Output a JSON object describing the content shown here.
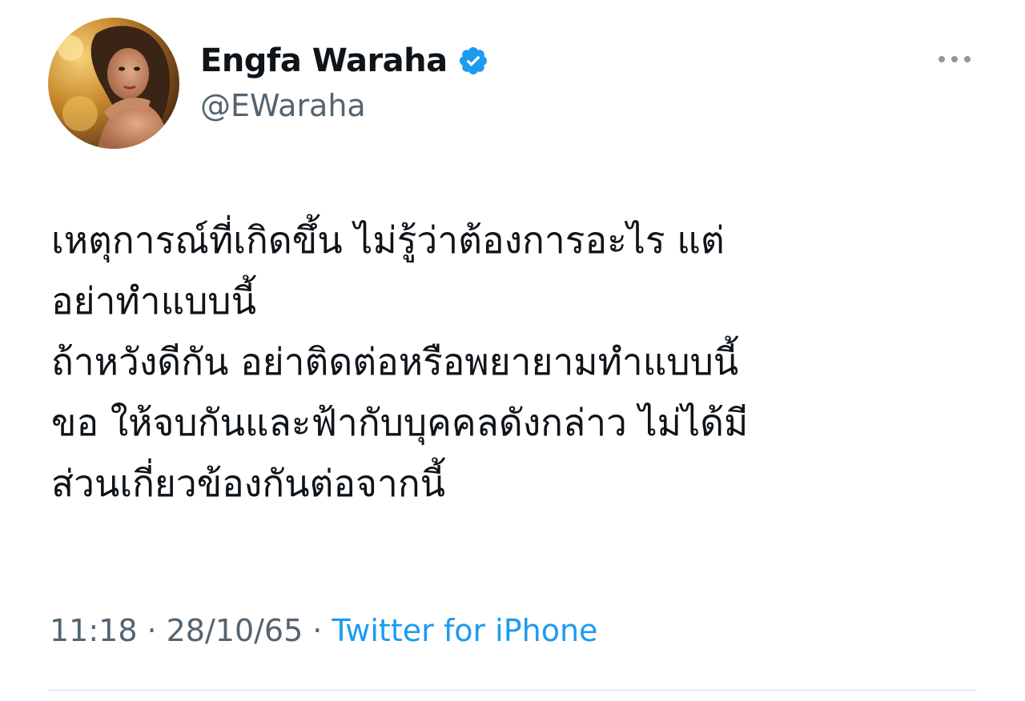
{
  "tweet": {
    "author": {
      "display_name": "Engfa Waraha",
      "handle": "@EWaraha",
      "verified_icon": "verified-badge-icon",
      "avatar_icon": "avatar-photo"
    },
    "more_icon": "more-dots-icon",
    "lines": [
      "เหตุการณ์ที่เกิดขึ้น ไม่รู้ว่าต้องการอะไร แต่",
      "อย่าทำแบบนี้",
      "ถ้าหวังดีกัน อย่าติดต่อหรือพยายามทำแบบนี้",
      "ขอ ให้จบกันและฟ้ากับบุคคลดังกล่าว ไม่ได้มี",
      "ส่วนเกี่ยวข้องกันต่อจากนี้"
    ],
    "time": "11:18",
    "date": "28/10/65",
    "separator": "·",
    "source": "Twitter for iPhone"
  },
  "colors": {
    "text": "#0f1419",
    "secondary": "#536471",
    "accent": "#1d9bf0",
    "divider": "#cfd9de"
  }
}
